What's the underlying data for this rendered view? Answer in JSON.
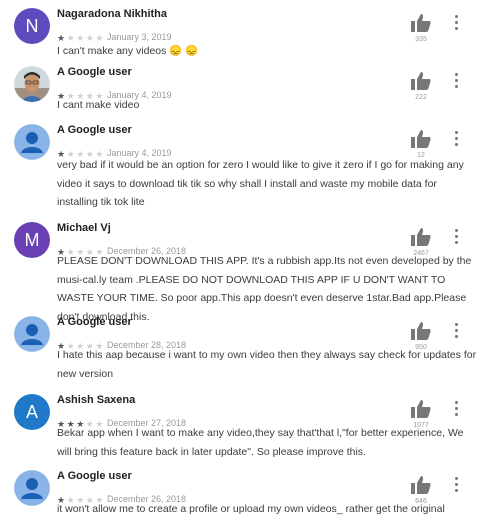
{
  "reviews": [
    {
      "name": "Nagaradona Nikhitha",
      "initial": "N",
      "avatar": "letter",
      "color": "#5e4bbd",
      "rating": 1,
      "date": "January 3, 2019",
      "likes": "335",
      "text": "I can't make any videos 😞 😞"
    },
    {
      "name": "A Google user",
      "initial": "",
      "avatar": "photo",
      "color": "#8ab4e8",
      "rating": 1,
      "date": "January 4, 2019",
      "likes": "222",
      "text": "I cant make video"
    },
    {
      "name": "A Google user",
      "initial": "",
      "avatar": "generic",
      "color": "#8ab4e8",
      "rating": 1,
      "date": "January 4, 2019",
      "likes": "12",
      "text": "very bad if it would be an option for zero I would like to give it zero if I go for making any video it says to download tik tik so why shall I install and waste my mobile data for installing tik tok lite"
    },
    {
      "name": "Michael Vj",
      "initial": "M",
      "avatar": "letter",
      "color": "#6a3fb4",
      "rating": 1,
      "date": "December 26, 2018",
      "likes": "2467",
      "text": "PLEASE DON'T DOWNLOAD THIS APP. It's a rubbish app.Its not even developed by the musi-cal.ly team .PLEASE DO NOT DOWNLOAD THIS APP IF U DON'T WANT TO WASTE YOUR TIME. So poor app.This app doesn't even deserve 1star.Bad app.Please don't download this."
    },
    {
      "name": "A Google user",
      "initial": "",
      "avatar": "generic",
      "color": "#8ab4e8",
      "rating": 1,
      "date": "December 28, 2018",
      "likes": "950",
      "text": "I hate this aap because i want to my own video then they always say check for updates for new version"
    },
    {
      "name": "Ashish Saxena",
      "initial": "A",
      "avatar": "letter",
      "color": "#1f78c8",
      "rating": 3,
      "date": "December 27, 2018",
      "likes": "1077",
      "text": "Bekar app when I want to make any video,they say that'that l,\"for better experience, We will bring this feature back in later update\". So please improve this."
    },
    {
      "name": "A Google user",
      "initial": "",
      "avatar": "generic",
      "color": "#8ab4e8",
      "rating": 1,
      "date": "December 26, 2018",
      "likes": "646",
      "text": "it won't allow me to create a profile or upload my own videos_ rather get the original"
    }
  ],
  "icons": {
    "thumb": "thumbs-up-icon",
    "more": "more-vert-icon",
    "star": "star-icon"
  }
}
